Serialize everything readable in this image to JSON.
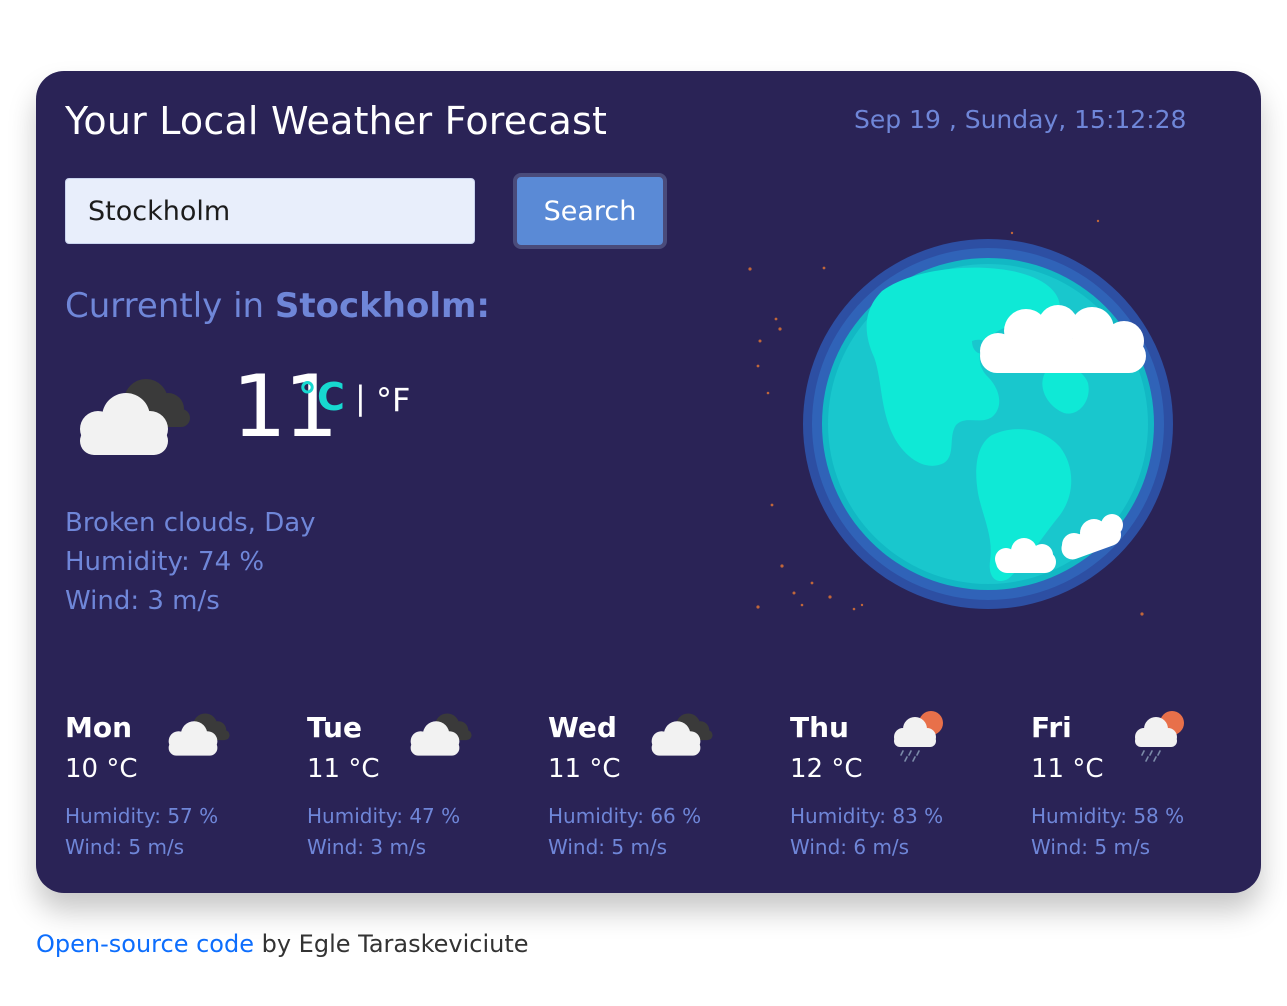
{
  "header": {
    "title": "Your Local Weather Forecast",
    "datetime": "Sep 19 , Sunday, 15:12:28"
  },
  "search": {
    "value": "Stockholm",
    "button_label": "Search"
  },
  "current": {
    "heading_prefix": "Currently in",
    "city": "Stockholm:",
    "temperature": "11",
    "unit_celsius": "°C",
    "unit_separator": "|",
    "unit_fahrenheit": "°F",
    "description": "Broken clouds, Day",
    "humidity": "Humidity: 74 %",
    "wind": "Wind: 3 m/s",
    "icon": "broken-clouds-icon"
  },
  "forecast": [
    {
      "day": "Mon",
      "temp": "10 °C",
      "humidity": "Humidity: 57 %",
      "wind": "Wind: 5 m/s",
      "icon": "broken-clouds-icon"
    },
    {
      "day": "Tue",
      "temp": "11 °C",
      "humidity": "Humidity: 47 %",
      "wind": "Wind: 3 m/s",
      "icon": "broken-clouds-icon"
    },
    {
      "day": "Wed",
      "temp": "11 °C",
      "humidity": "Humidity: 66 %",
      "wind": "Wind: 5 m/s",
      "icon": "broken-clouds-icon"
    },
    {
      "day": "Thu",
      "temp": "12 °C",
      "humidity": "Humidity: 83 %",
      "wind": "Wind: 6 m/s",
      "icon": "sun-rain-cloud-icon"
    },
    {
      "day": "Fri",
      "temp": "11 °C",
      "humidity": "Humidity: 58 %",
      "wind": "Wind: 5 m/s",
      "icon": "sun-rain-cloud-icon"
    }
  ],
  "footer": {
    "link_text": "Open-source code",
    "suffix": " by Egle Taraskeviciute"
  },
  "colors": {
    "card_background": "#2a2356",
    "accent_text": "#6f86d8",
    "celsius_accent": "#17d8d0",
    "button": "#5a8ad6",
    "link": "#0d6efd"
  }
}
